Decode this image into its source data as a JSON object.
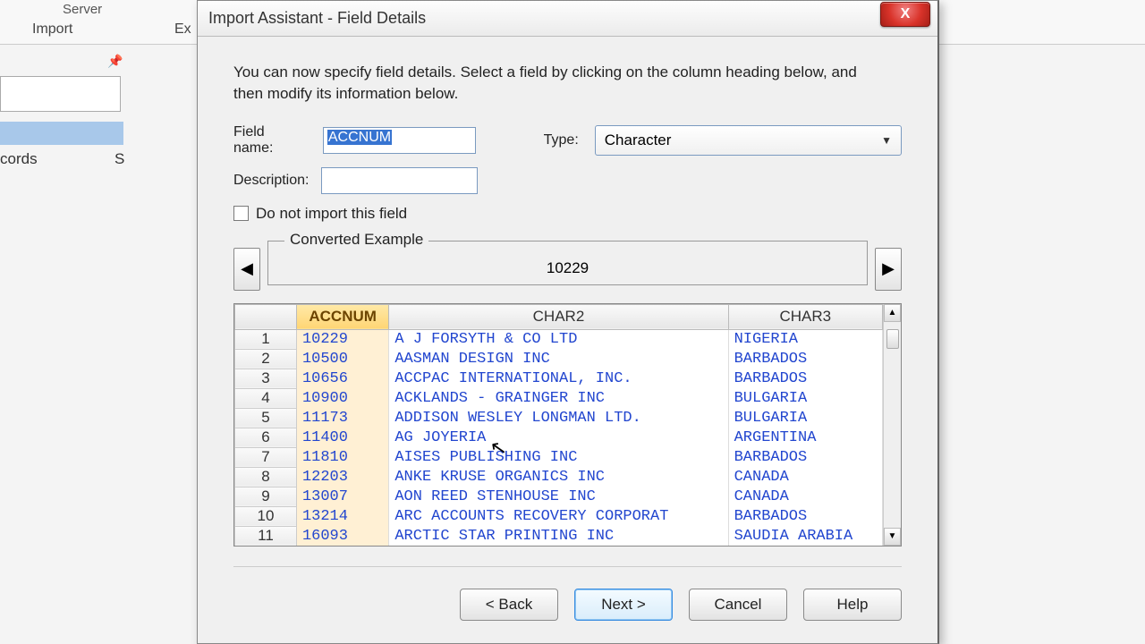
{
  "background": {
    "server": "Server",
    "import": "Import",
    "ex": "Ex",
    "records": "cords",
    "s": "S"
  },
  "dialog": {
    "title": "Import Assistant - Field Details",
    "close": "X",
    "instruction": "You can now specify field details. Select a field by clicking on the column heading below, and then modify its information below.",
    "field_name_label": "Field name:",
    "field_name_value": "ACCNUM",
    "type_label": "Type:",
    "type_value": "Character",
    "description_label": "Description:",
    "description_value": "",
    "do_not_import_label": "Do not import this field",
    "converted_legend": "Converted Example",
    "converted_value": "10229",
    "columns": {
      "c0": "",
      "c1": "ACCNUM",
      "c2": "CHAR2",
      "c3": "CHAR3"
    },
    "rows": [
      {
        "n": "1",
        "a": "10229",
        "b": "A J FORSYTH & CO LTD",
        "c": "NIGERIA"
      },
      {
        "n": "2",
        "a": "10500",
        "b": "AASMAN DESIGN INC",
        "c": "BARBADOS"
      },
      {
        "n": "3",
        "a": "10656",
        "b": "ACCPAC INTERNATIONAL, INC.",
        "c": "BARBADOS"
      },
      {
        "n": "4",
        "a": "10900",
        "b": "ACKLANDS - GRAINGER INC",
        "c": "BULGARIA"
      },
      {
        "n": "5",
        "a": "11173",
        "b": "ADDISON WESLEY LONGMAN LTD.",
        "c": "BULGARIA"
      },
      {
        "n": "6",
        "a": "11400",
        "b": "AG JOYERIA",
        "c": "ARGENTINA"
      },
      {
        "n": "7",
        "a": "11810",
        "b": "AISES PUBLISHING INC",
        "c": "BARBADOS"
      },
      {
        "n": "8",
        "a": "12203",
        "b": "ANKE KRUSE ORGANICS INC",
        "c": "CANADA"
      },
      {
        "n": "9",
        "a": "13007",
        "b": "AON REED STENHOUSE INC",
        "c": "CANADA"
      },
      {
        "n": "10",
        "a": "13214",
        "b": "ARC ACCOUNTS RECOVERY CORPORAT",
        "c": "BARBADOS"
      },
      {
        "n": "11",
        "a": "16093",
        "b": "ARCTIC STAR PRINTING INC",
        "c": "SAUDIA ARABIA"
      }
    ],
    "buttons": {
      "back": "< Back",
      "next": "Next >",
      "cancel": "Cancel",
      "help": "Help"
    }
  }
}
